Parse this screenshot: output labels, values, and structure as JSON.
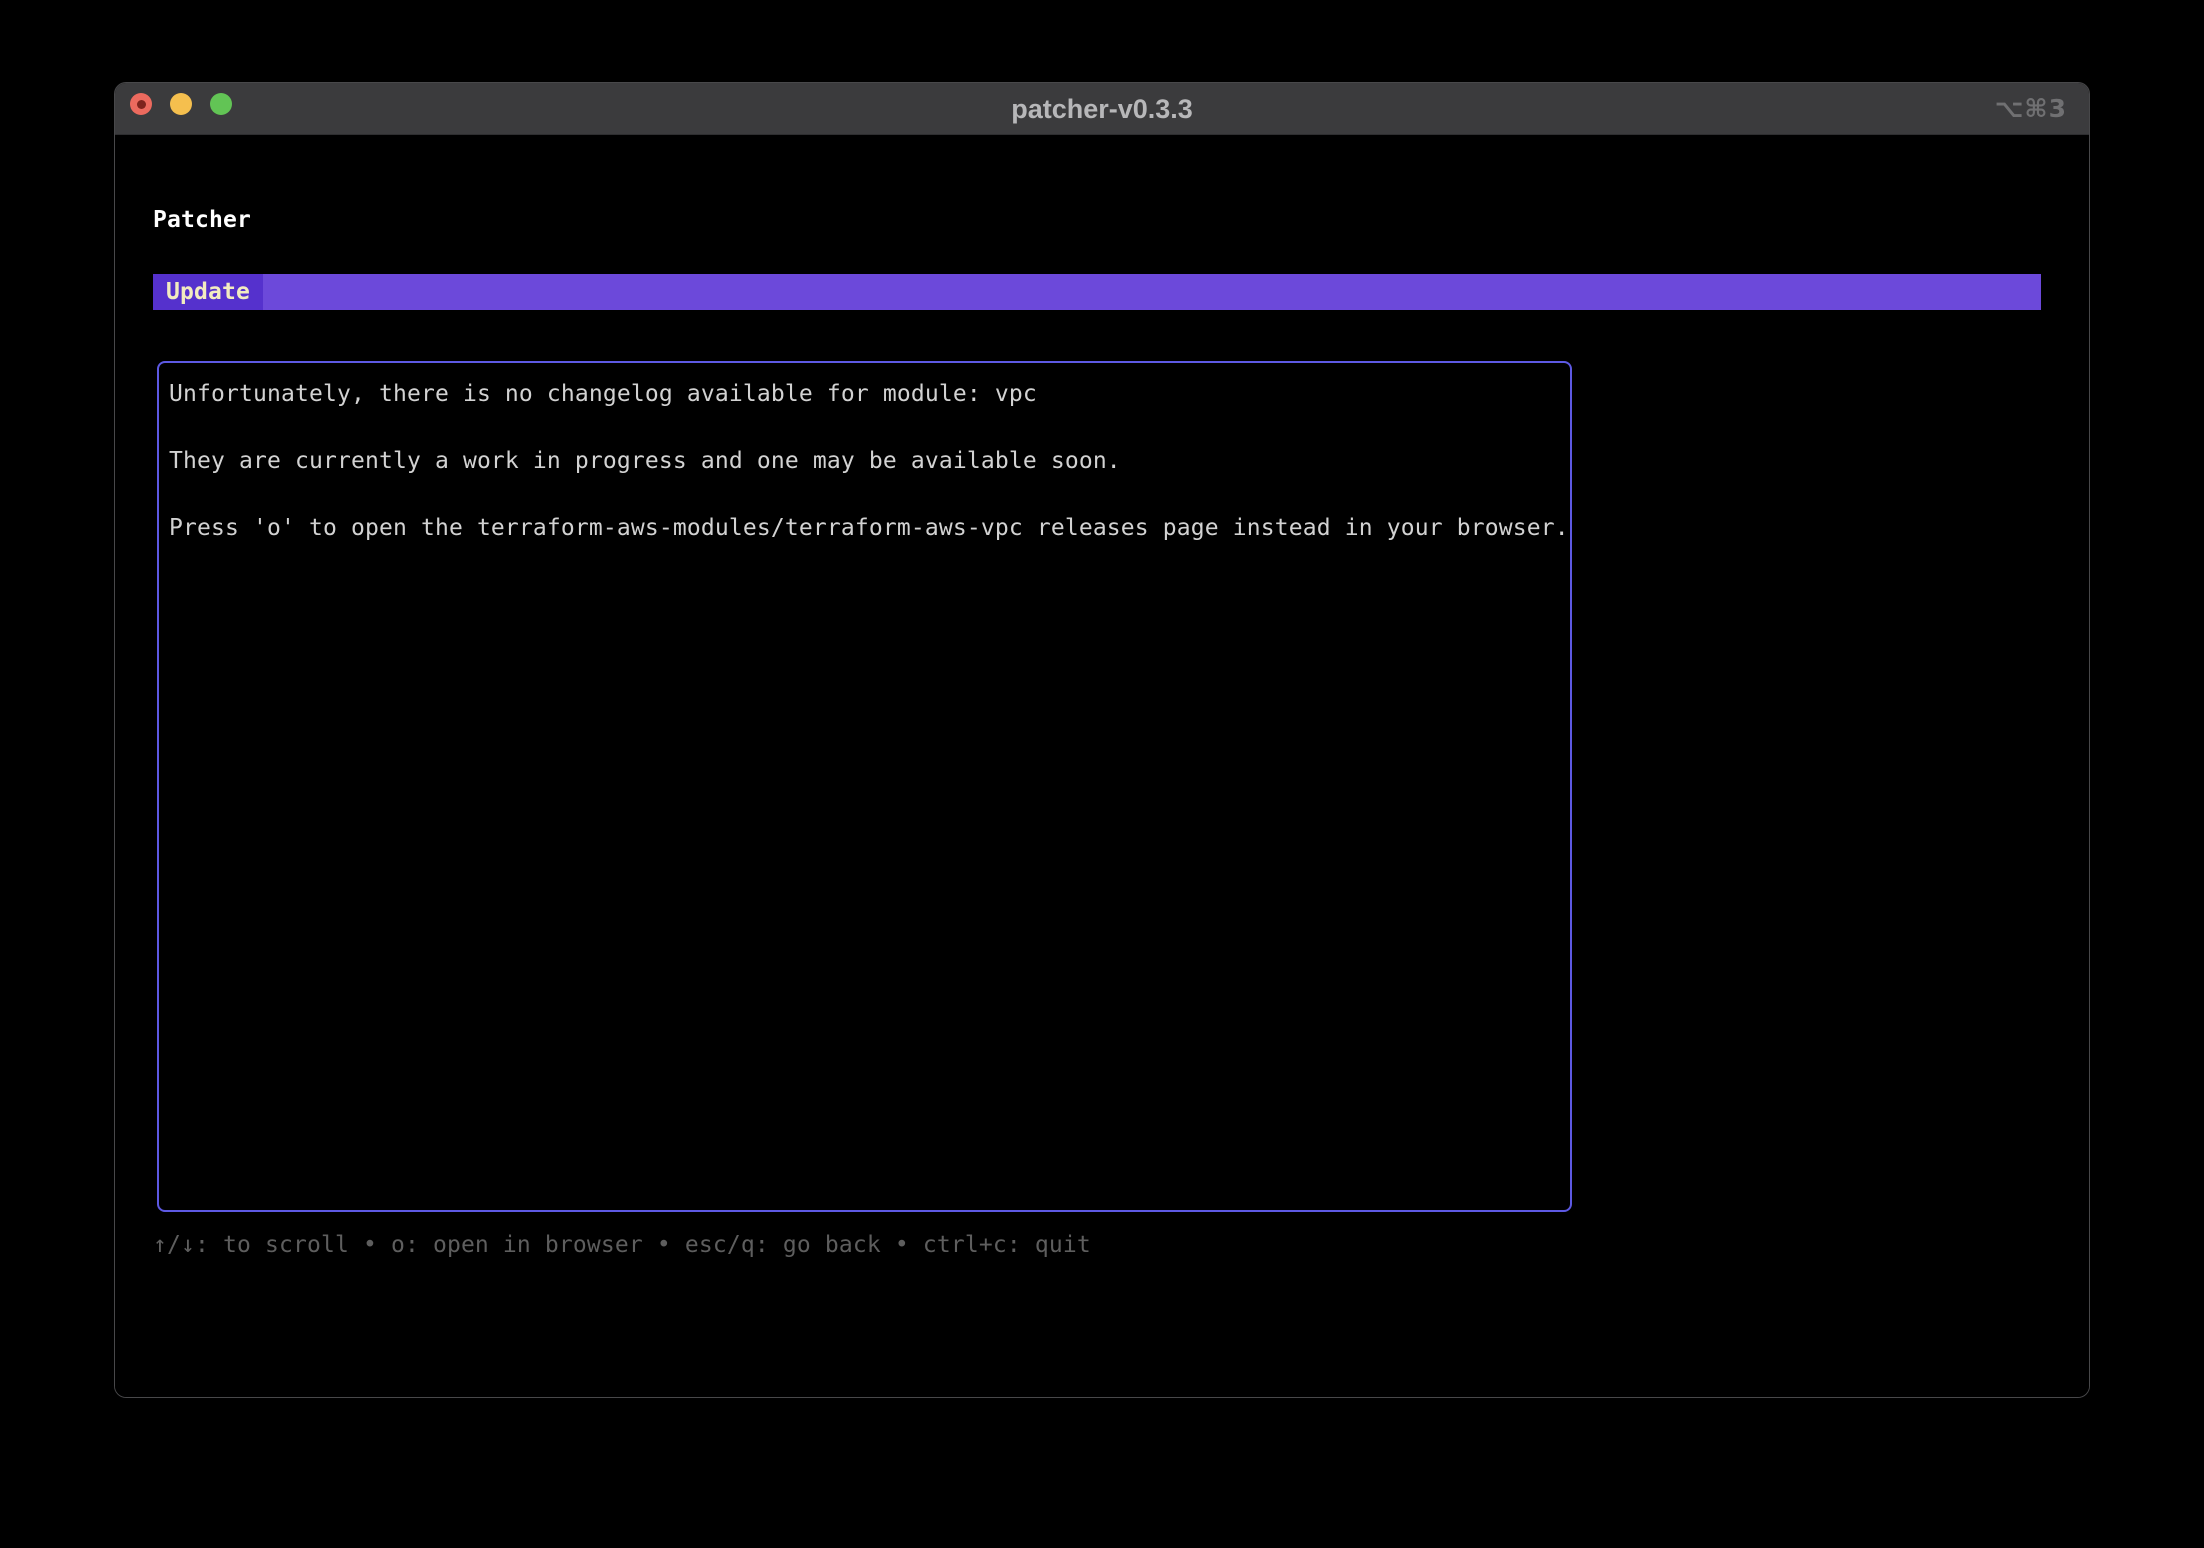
{
  "colors": {
    "accent-bar": "#6c49da",
    "accent-tab": "#5531cd",
    "tab-text": "#f2ecc0",
    "box-border": "#5d59e3",
    "body-text": "#d2d2d2",
    "help-text": "#5e5e5e",
    "titlebar-bg": "#3b3b3d",
    "titlebar-text": "#b7b7b9",
    "traffic-red": "#ec6a5e",
    "traffic-yellow": "#f5bf4e",
    "traffic-green": "#62c455"
  },
  "window": {
    "title": "patcher-v0.3.3",
    "shortcut_hint": "⌥⌘3"
  },
  "main": {
    "heading": "Patcher",
    "tab_label": "Update",
    "changelog": {
      "paragraphs": [
        "Unfortunately, there is no changelog available for module: vpc",
        "They are currently a work in progress and one may be available soon.",
        "Press 'o' to open the terraform-aws-modules/terraform-aws-vpc releases page instead in your browser."
      ]
    },
    "help": "↑/↓: to scroll • o: open in browser • esc/q: go back • ctrl+c: quit"
  }
}
